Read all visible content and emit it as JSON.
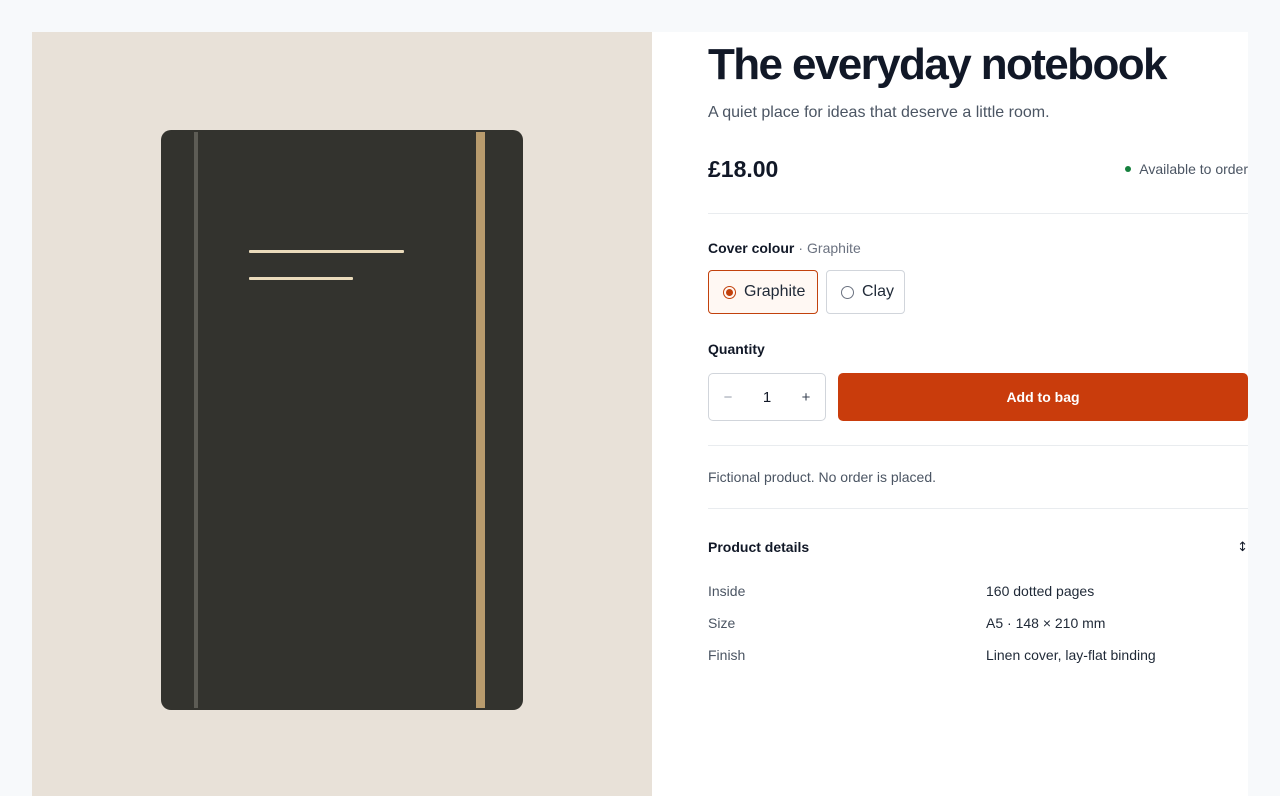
{
  "product": {
    "title": "The everyday notebook",
    "subtitle": "A quiet place for ideas that deserve a little room.",
    "price": "£18.00",
    "availability": "Available to order",
    "availability_color": "#15803d"
  },
  "cover_colour": {
    "label": "Cover colour",
    "separator": "·",
    "selected": "Graphite",
    "options": [
      {
        "label": "Graphite",
        "selected": true,
        "cover_color": "#33332e"
      },
      {
        "label": "Clay",
        "selected": false
      }
    ]
  },
  "quantity": {
    "label": "Quantity",
    "value": "1",
    "decrement_symbol": "−",
    "increment_symbol": "+"
  },
  "actions": {
    "add_to_bag": "Add to bag",
    "accent_color": "#c93c0c"
  },
  "note": "Fictional product. No order is placed.",
  "details": {
    "title": "Product details",
    "toggle_icon": "↕",
    "rows": [
      {
        "key": "Inside",
        "value": "160 dotted pages"
      },
      {
        "key": "Size",
        "value": "A5 · 148 × 210 mm"
      },
      {
        "key": "Finish",
        "value": "Linen cover, lay-flat binding"
      }
    ]
  },
  "image": {
    "background_color": "#e8e1d8",
    "icon": "notebook-illustration"
  }
}
